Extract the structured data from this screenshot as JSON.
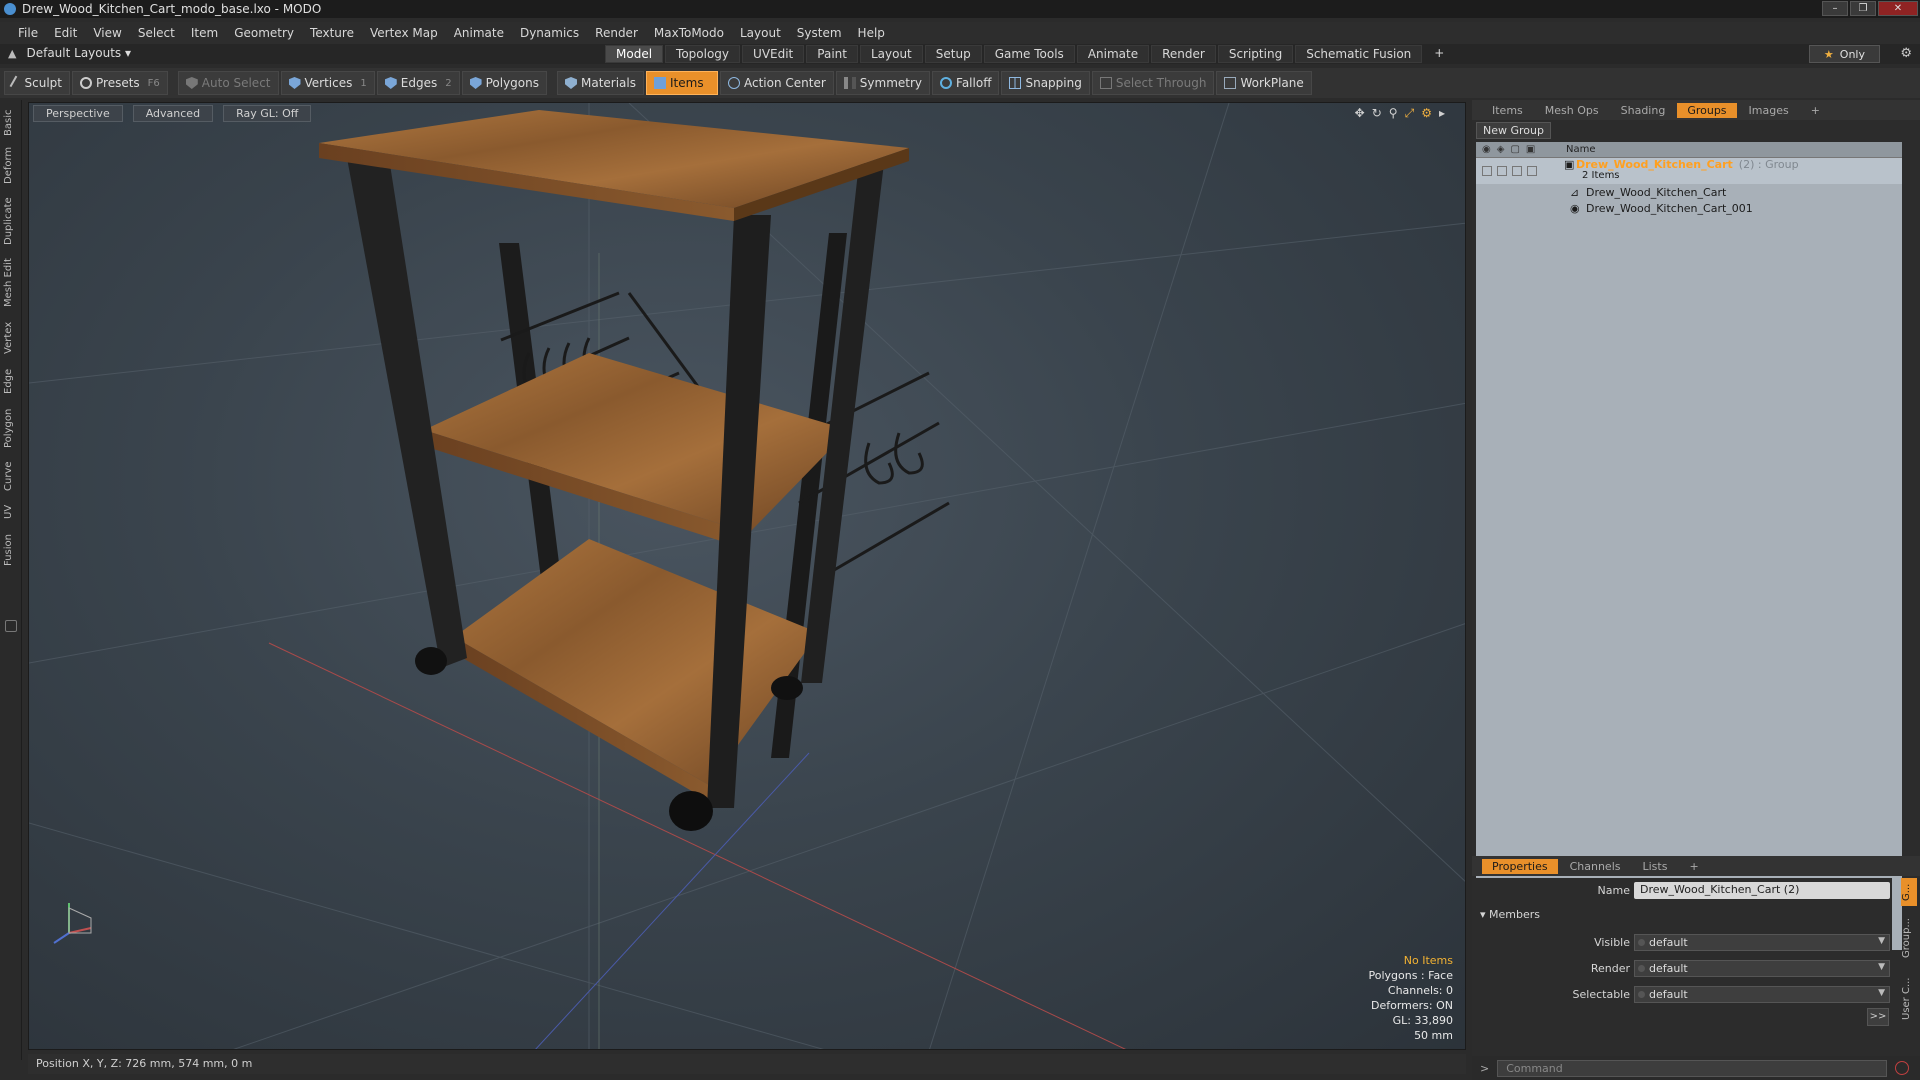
{
  "window": {
    "title": "Drew_Wood_Kitchen_Cart_modo_base.lxo - MODO"
  },
  "menu": [
    "File",
    "Edit",
    "View",
    "Select",
    "Item",
    "Geometry",
    "Texture",
    "Vertex Map",
    "Animate",
    "Dynamics",
    "Render",
    "MaxToModo",
    "Layout",
    "System",
    "Help"
  ],
  "layoutbar": {
    "layouts_label": "Default Layouts ▾",
    "tabs": [
      "Model",
      "Topology",
      "UVEdit",
      "Paint",
      "Layout",
      "Setup",
      "Game Tools",
      "Animate",
      "Render",
      "Scripting",
      "Schematic Fusion"
    ],
    "active_tab": "Model",
    "only_label": "Only"
  },
  "toolbar": {
    "sculpt": "Sculpt",
    "presets": "Presets",
    "presets_key": "F6",
    "auto_select": "Auto Select",
    "vertices": "Vertices",
    "vertices_key": "1",
    "edges": "Edges",
    "edges_key": "2",
    "polygons": "Polygons",
    "materials": "Materials",
    "items": "Items",
    "action_center": "Action Center",
    "symmetry": "Symmetry",
    "falloff": "Falloff",
    "snapping": "Snapping",
    "select_through": "Select Through",
    "workplane": "WorkPlane"
  },
  "left_tabs": [
    "Basic",
    "Deform",
    "Duplicate",
    "Mesh Edit",
    "Vertex",
    "Edge",
    "Polygon",
    "Curve",
    "UV",
    "Fusion"
  ],
  "viewport": {
    "perspective": "Perspective",
    "advanced": "Advanced",
    "raygl": "Ray GL: Off",
    "hud": {
      "items": "No Items",
      "polygons": "Polygons : Face",
      "channels": "Channels: 0",
      "deformers": "Deformers: ON",
      "gl": "GL: 33,890",
      "scale": "50 mm"
    }
  },
  "statusbar": {
    "position": "Position X, Y, Z:  726 mm, 574 mm, 0 m"
  },
  "groups_panel": {
    "tabs": [
      "Items",
      "Mesh Ops",
      "Shading",
      "Groups",
      "Images"
    ],
    "active_tab": "Groups",
    "new_group": "New Group",
    "name_header": "Name",
    "group_name": "Drew_Wood_Kitchen_Cart",
    "group_extra": "(2) : Group",
    "group_count": "2 Items",
    "children": [
      "Drew_Wood_Kitchen_Cart",
      "Drew_Wood_Kitchen_Cart_001"
    ]
  },
  "properties_panel": {
    "tabs": [
      "Properties",
      "Channels",
      "Lists"
    ],
    "active_tab": "Properties",
    "name_label": "Name",
    "name_value": "Drew_Wood_Kitchen_Cart (2)",
    "members_label": "Members",
    "visible_label": "Visible",
    "visible_value": "default",
    "render_label": "Render",
    "render_value": "default",
    "selectable_label": "Selectable",
    "selectable_value": "default",
    "expand": ">>",
    "side_tabs": [
      "G...",
      "Group...",
      "User C..."
    ]
  },
  "command": {
    "prompt": ">",
    "placeholder": "Command"
  },
  "colors": {
    "accent": "#e9902a",
    "group_name": "#ffa020",
    "hud_warning": "#f2b233"
  }
}
